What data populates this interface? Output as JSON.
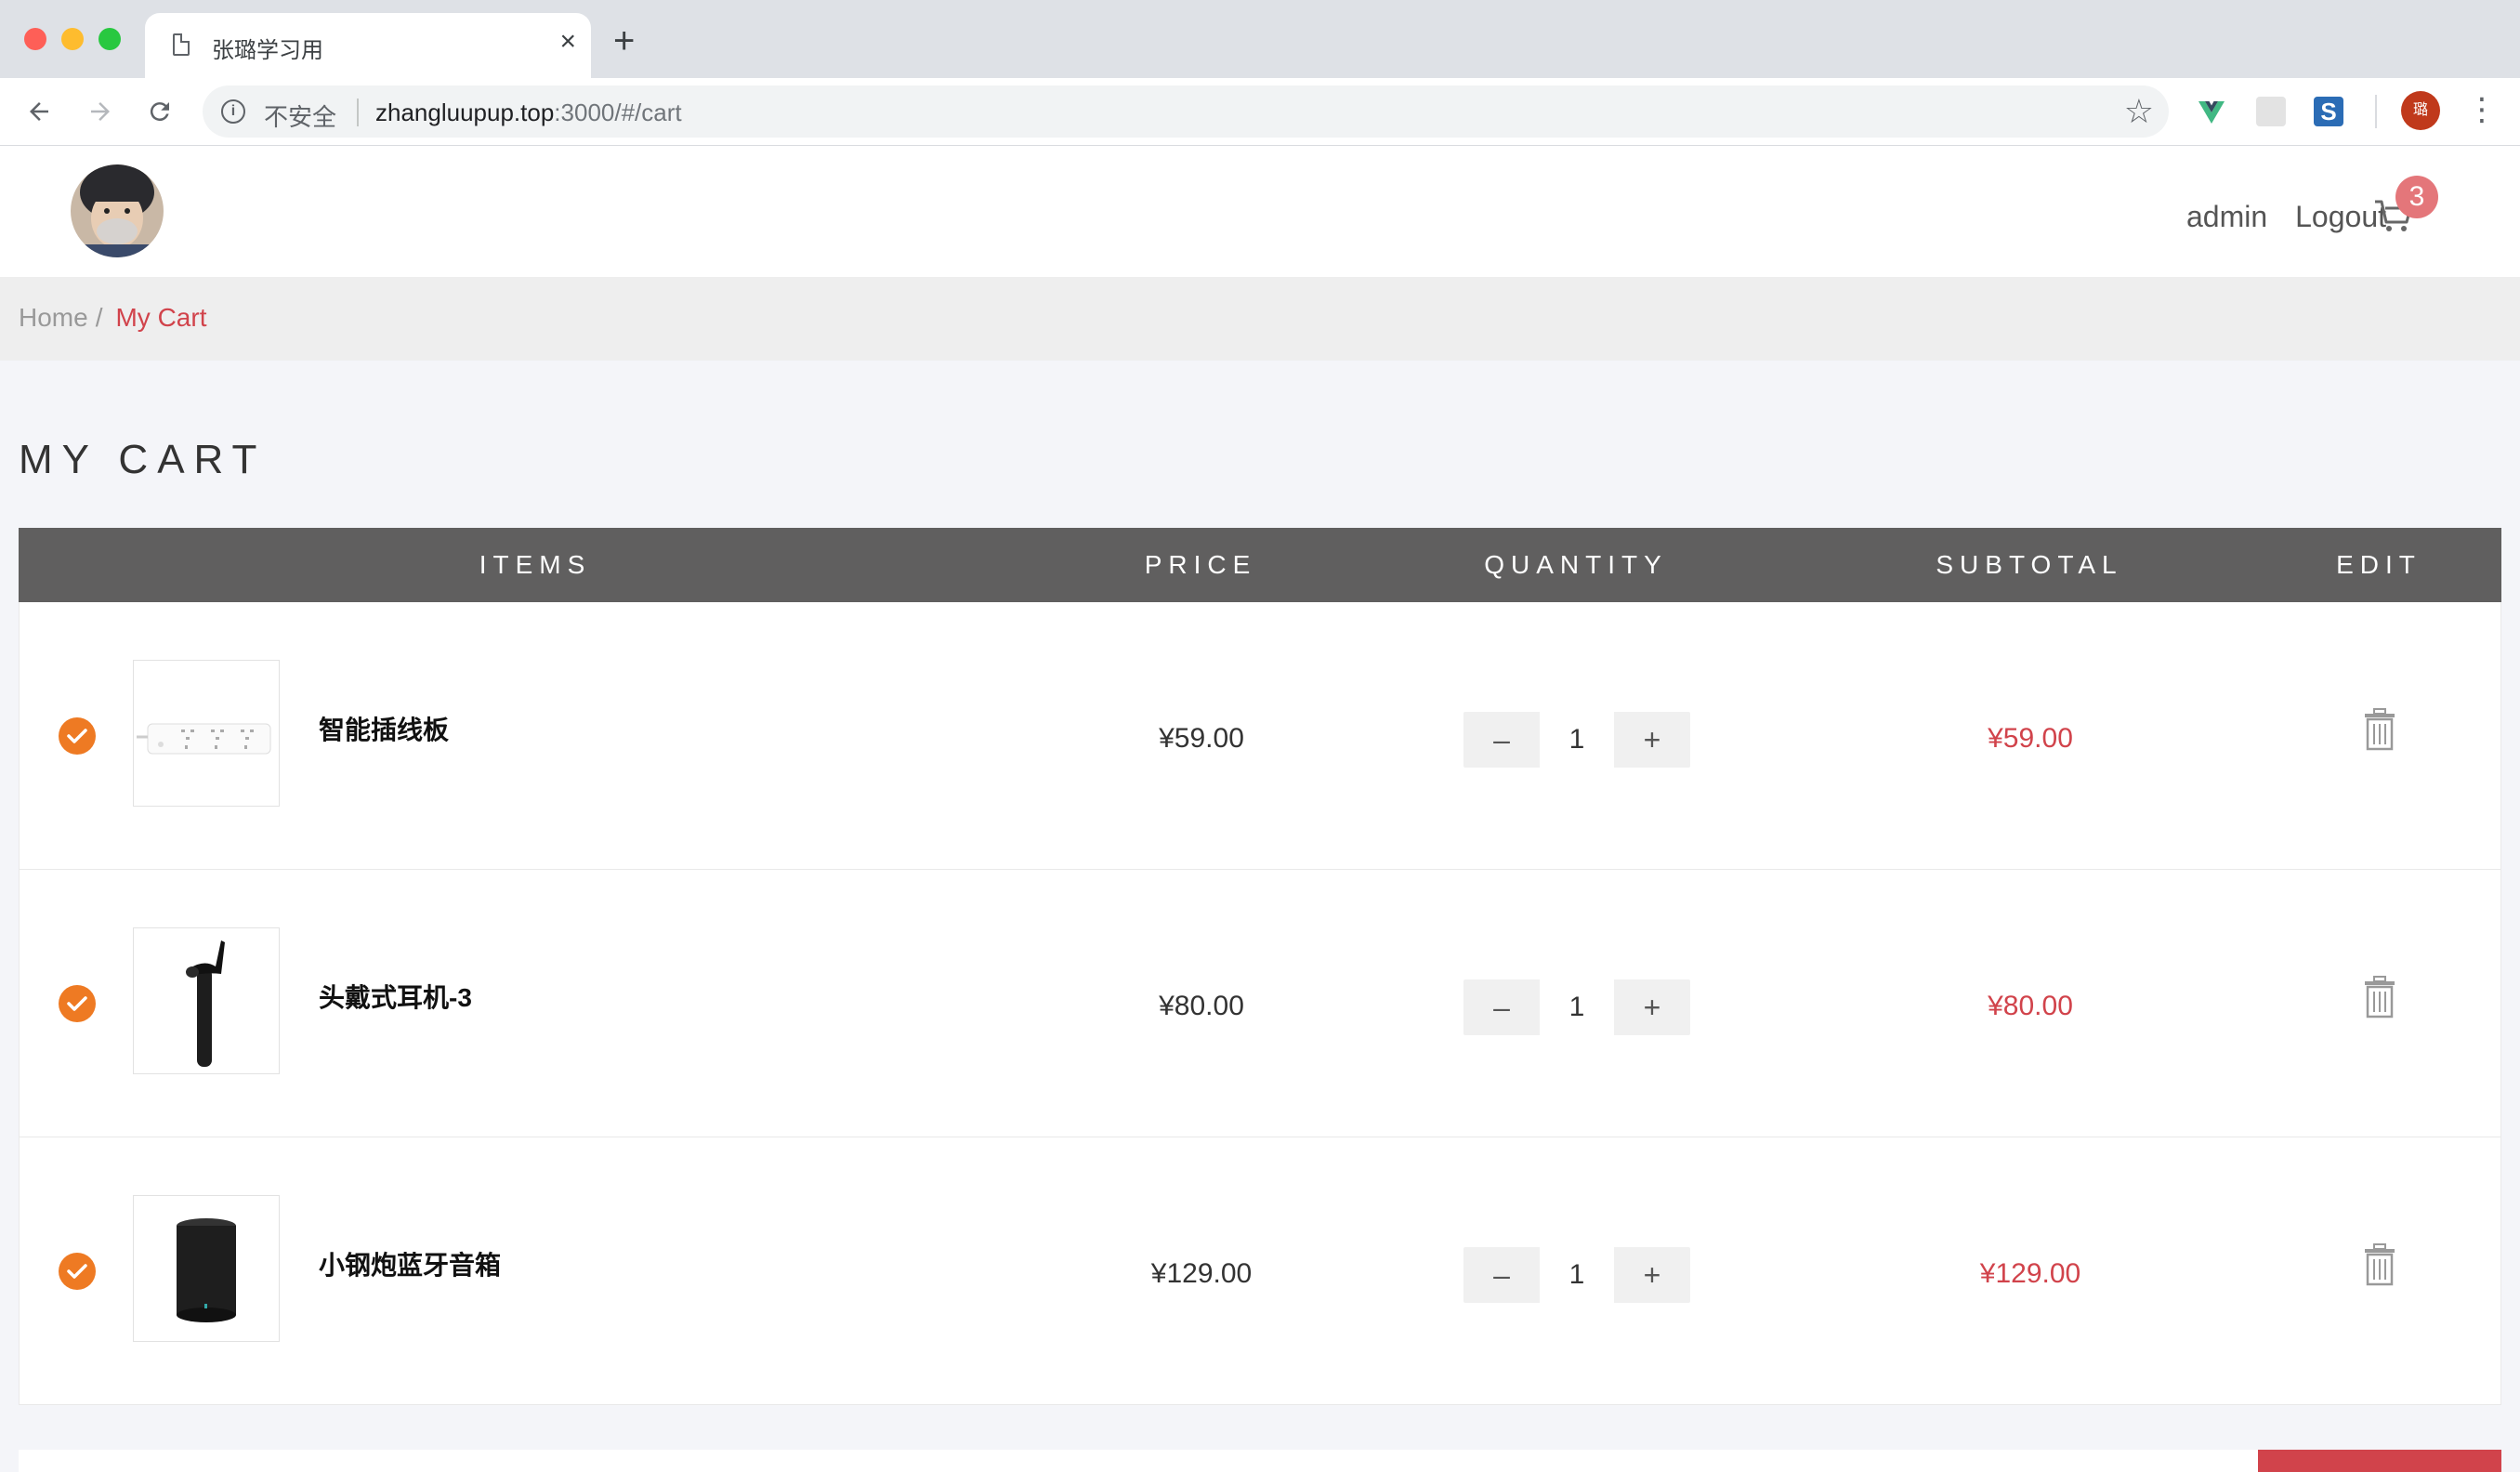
{
  "browser": {
    "tab_title": "张璐学习用",
    "security_label": "不安全",
    "url_host": "zhangluupup.top",
    "url_rest": ":3000/#/cart",
    "profile_initial": "璐",
    "extension_s_label": "S"
  },
  "header": {
    "username": "admin",
    "logout_label": "Logout",
    "cart_count": "3"
  },
  "breadcrumb": {
    "home": "Home",
    "separator": "/",
    "current": "My Cart"
  },
  "cart": {
    "title": "MY CART",
    "columns": {
      "items": "ITEMS",
      "price": "PRICE",
      "quantity": "QUANTITY",
      "subtotal": "SUBTOTAL",
      "edit": "EDIT"
    },
    "rows": [
      {
        "name": "智能插线板",
        "price": "¥59.00",
        "quantity": "1",
        "subtotal": "¥59.00",
        "checked": true,
        "thumb_icon": "power-strip-icon"
      },
      {
        "name": "头戴式耳机-3",
        "price": "¥80.00",
        "quantity": "1",
        "subtotal": "¥80.00",
        "checked": true,
        "thumb_icon": "bluetooth-headset-icon"
      },
      {
        "name": "小钢炮蓝牙音箱",
        "price": "¥129.00",
        "quantity": "1",
        "subtotal": "¥129.00",
        "checked": true,
        "thumb_icon": "speaker-icon"
      }
    ],
    "minus_label": "–",
    "plus_label": "+"
  },
  "colors": {
    "accent_red": "#d1434b",
    "check_orange": "#ee7a23",
    "table_header": "#605f5f",
    "badge": "#e4767a"
  }
}
